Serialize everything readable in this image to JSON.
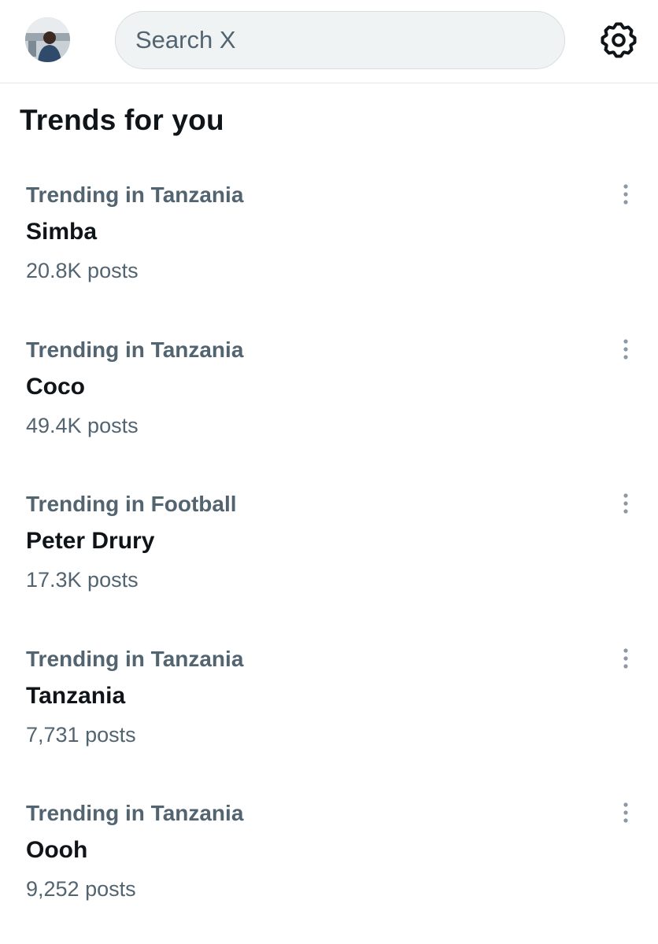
{
  "header": {
    "search_placeholder": "Search X",
    "avatar_icon": "user-avatar",
    "settings_icon": "gear-icon"
  },
  "section_title": "Trends for you",
  "trends": [
    {
      "context": "Trending in Tanzania",
      "name": "Simba",
      "count": "20.8K posts"
    },
    {
      "context": "Trending in Tanzania",
      "name": "Coco",
      "count": "49.4K posts"
    },
    {
      "context": "Trending in Football",
      "name": "Peter Drury",
      "count": "17.3K posts"
    },
    {
      "context": "Trending in Tanzania",
      "name": "Tanzania",
      "count": "7,731 posts"
    },
    {
      "context": "Trending in Tanzania",
      "name": "Oooh",
      "count": "9,252 posts"
    }
  ],
  "colors": {
    "primary_text": "#0f1419",
    "secondary_text": "#536471",
    "search_bg": "#eff3f4",
    "divider": "#e6e9eb"
  }
}
